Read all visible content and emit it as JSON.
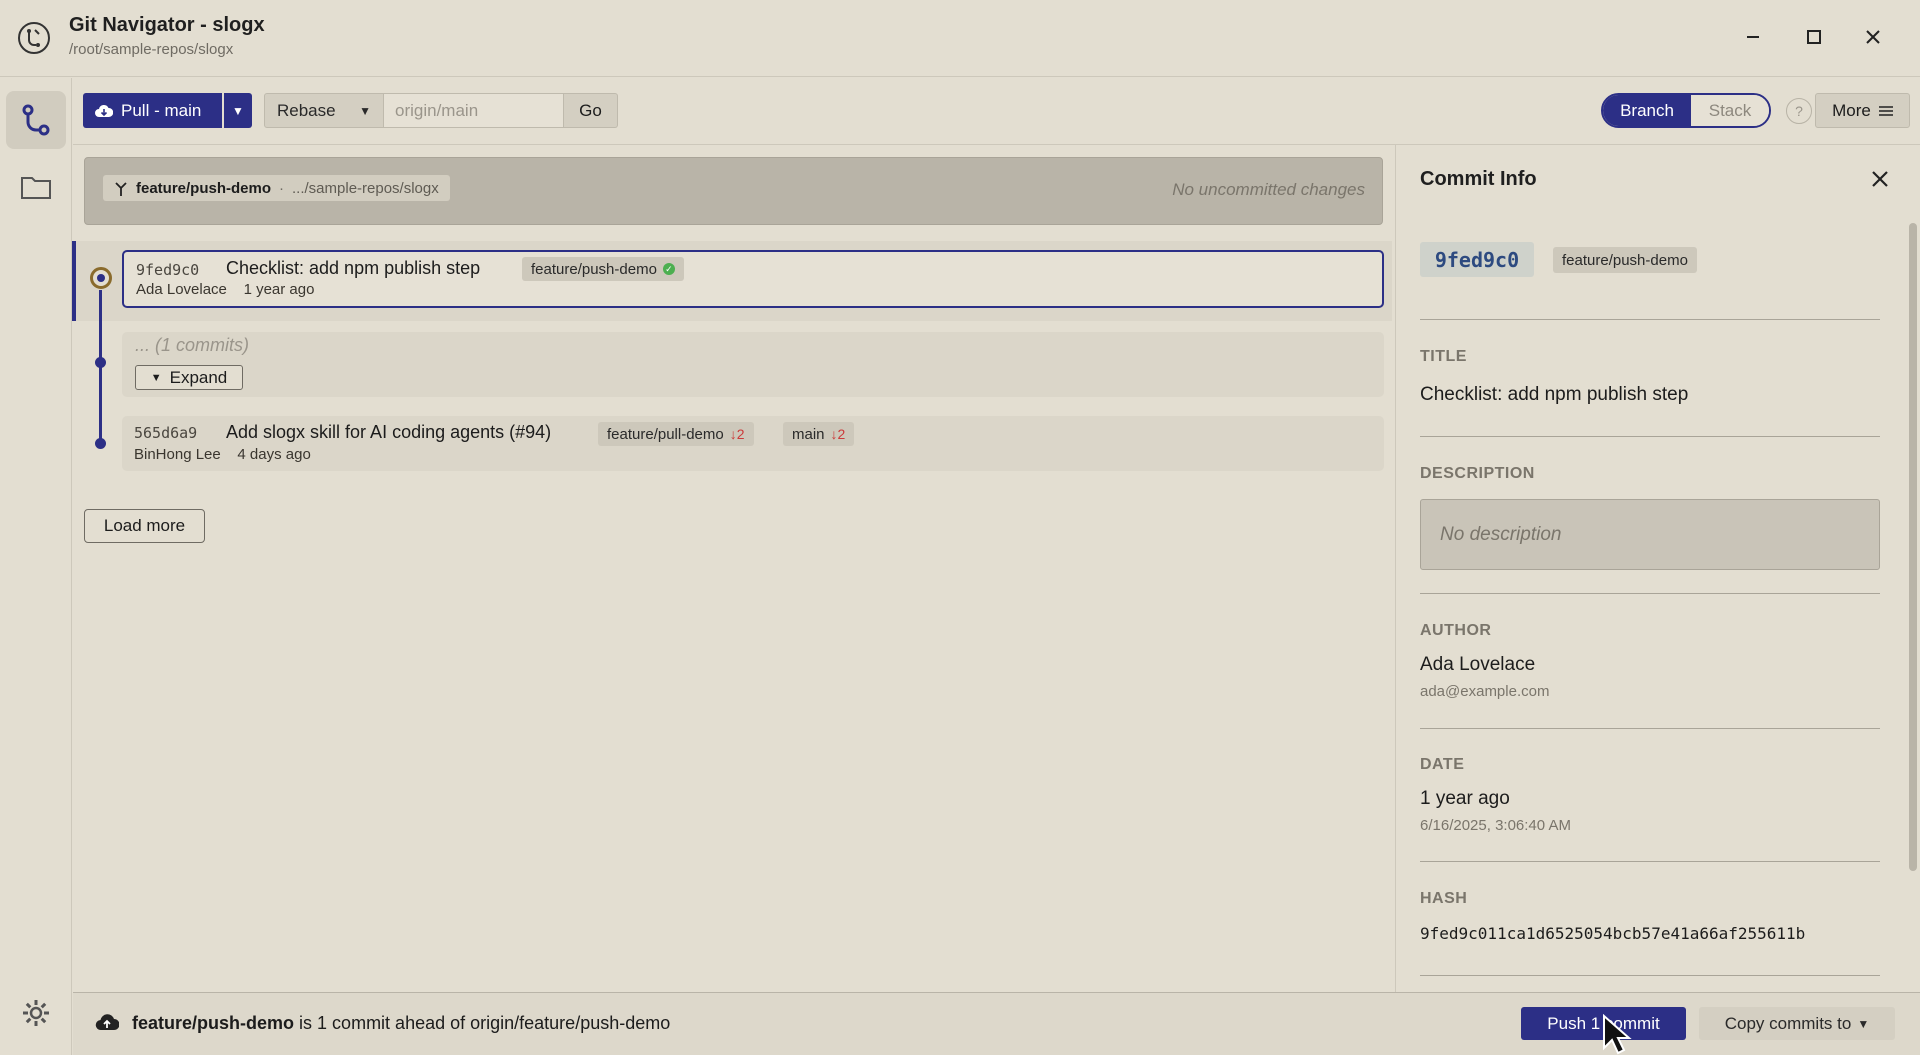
{
  "window": {
    "title": "Git Navigator - slogx",
    "path": "/root/sample-repos/slogx"
  },
  "toolbar": {
    "pull_label": "Pull - main",
    "mode_select": "Rebase",
    "target_placeholder": "origin/main",
    "go_label": "Go",
    "view_branch": "Branch",
    "view_stack": "Stack",
    "help_label": "?",
    "more_label": "More"
  },
  "status": {
    "branch": "feature/push-demo",
    "separator": "·",
    "repo_path": ".../sample-repos/slogx",
    "changes": "No uncommitted changes"
  },
  "commits": [
    {
      "hash": "9fed9c0",
      "title": "Checklist: add npm publish step",
      "author": "Ada Lovelace",
      "age": "1 year ago",
      "tags": [
        {
          "name": "feature/push-demo",
          "status": "ok"
        }
      ]
    },
    {
      "hash": "565d6a9",
      "title": "Add slogx skill for AI coding agents (#94)",
      "author": "BinHong Lee",
      "age": "4 days ago",
      "tags": [
        {
          "name": "feature/pull-demo",
          "behind": "↓2"
        },
        {
          "name": "main",
          "behind": "↓2"
        }
      ]
    }
  ],
  "collapsed": {
    "text": "... (1 commits)",
    "expand_label": "Expand"
  },
  "load_more_label": "Load more",
  "panel": {
    "title": "Commit Info",
    "hash_short": "9fed9c0",
    "branch": "feature/push-demo",
    "title_label": "TITLE",
    "title_value": "Checklist: add npm publish step",
    "description_label": "DESCRIPTION",
    "description_placeholder": "No description",
    "author_label": "AUTHOR",
    "author_name": "Ada Lovelace",
    "author_email": "ada@example.com",
    "date_label": "DATE",
    "date_relative": "1 year ago",
    "date_full": "6/16/2025, 3:06:40 AM",
    "hash_label": "HASH",
    "hash_full": "9fed9c011ca1d6525054bcb57e41a66af255611b"
  },
  "bottom": {
    "branch": "feature/push-demo",
    "message": "is 1 commit ahead of origin/feature/push-demo",
    "push_label": "Push 1 commit",
    "copy_label": "Copy commits to"
  },
  "colors": {
    "accent": "#2c2f86",
    "background": "#e3ded1",
    "behind": "#cc3a3a",
    "ok": "#4caf50"
  }
}
